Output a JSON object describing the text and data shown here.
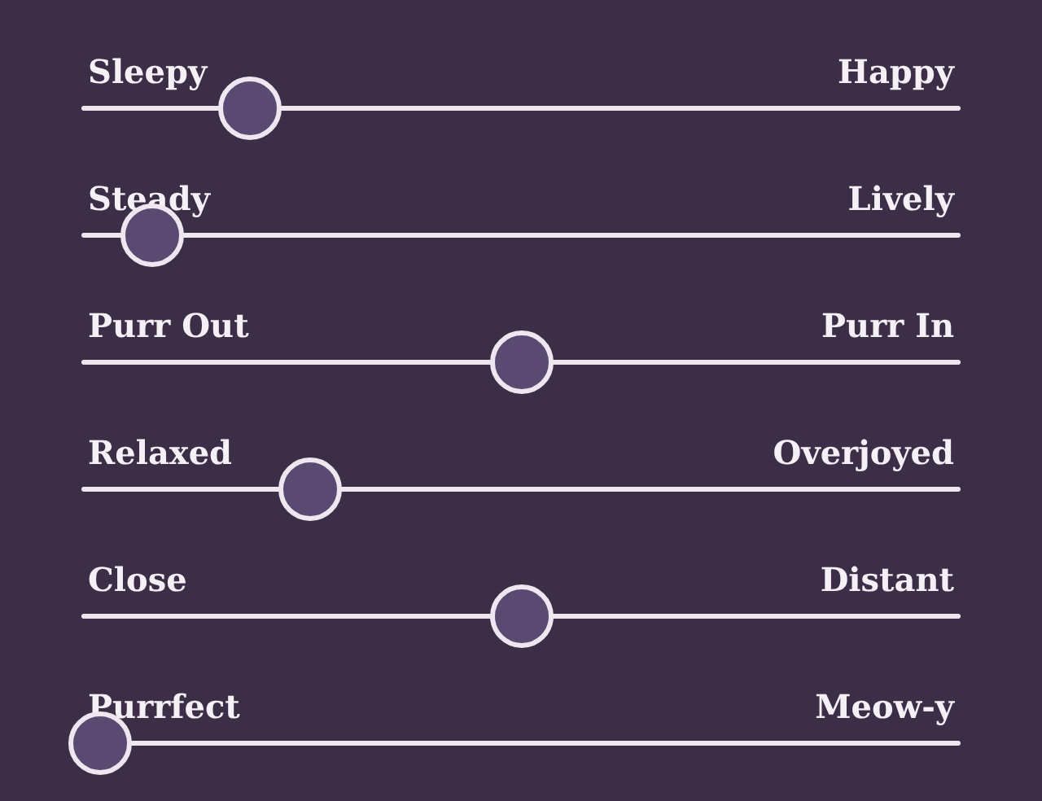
{
  "sliders": [
    {
      "left": "Sleepy",
      "right": "Happy",
      "level": 0.19
    },
    {
      "left": "Steady",
      "right": "Lively",
      "level": 0.08
    },
    {
      "left": "Purr Out",
      "right": "Purr In",
      "level": 0.5
    },
    {
      "left": "Relaxed",
      "right": "Overjoyed",
      "level": 0.26
    },
    {
      "left": "Close",
      "right": "Distant",
      "level": 0.5
    },
    {
      "left": "Purrfect",
      "right": "Meow-y",
      "level": 0.02
    }
  ]
}
